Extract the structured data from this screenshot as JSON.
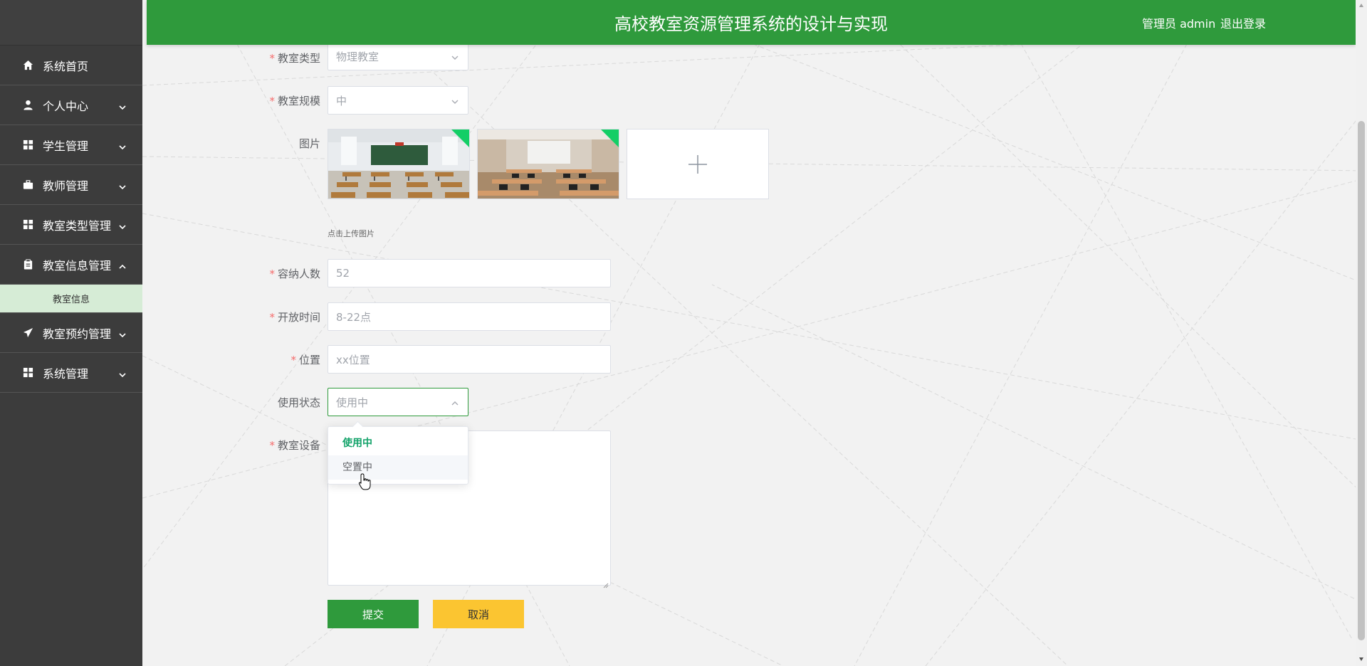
{
  "header": {
    "title": "高校教室资源管理系统的设计与实现",
    "user_label": "管理员 admin",
    "logout_label": "退出登录",
    "background_color": "#2f9a3c"
  },
  "sidebar": {
    "items": [
      {
        "label": "系统首页",
        "icon": "home-icon",
        "expandable": false
      },
      {
        "label": "个人中心",
        "icon": "user-icon",
        "expandable": true
      },
      {
        "label": "学生管理",
        "icon": "grid-icon",
        "expandable": true
      },
      {
        "label": "教师管理",
        "icon": "briefcase-icon",
        "expandable": true
      },
      {
        "label": "教室类型管理",
        "icon": "grid-icon",
        "expandable": true
      },
      {
        "label": "教室信息管理",
        "icon": "clipboard-icon",
        "expandable": true,
        "expanded": true
      },
      {
        "label": "教室预约管理",
        "icon": "send-icon",
        "expandable": true
      },
      {
        "label": "系统管理",
        "icon": "grid-icon",
        "expandable": true
      }
    ],
    "submenu_active": "教室信息"
  },
  "form": {
    "room_type": {
      "label": "教室类型",
      "value": "物理教室",
      "required": true
    },
    "room_scale": {
      "label": "教室规模",
      "value": "中",
      "required": true
    },
    "images": {
      "label": "图片",
      "tip": "点击上传图片"
    },
    "capacity": {
      "label": "容纳人数",
      "value": "52",
      "required": true
    },
    "open_time": {
      "label": "开放时间",
      "value": "8-22点",
      "required": true
    },
    "location": {
      "label": "位置",
      "value": "xx位置",
      "required": true
    },
    "status": {
      "label": "使用状态",
      "value": "使用中",
      "required": false
    },
    "equipment": {
      "label": "教室设备",
      "value": "",
      "required": true
    },
    "status_options": [
      "使用中",
      "空置中"
    ],
    "submit_label": "提交",
    "cancel_label": "取消"
  },
  "colors": {
    "accent": "#2f9a3c",
    "cancel": "#fbc531",
    "required": "#f56c6c",
    "selected_option": "#13a36a"
  }
}
